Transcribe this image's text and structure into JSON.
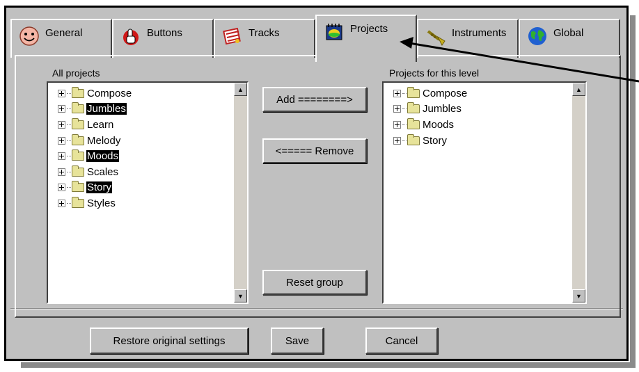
{
  "tabs": [
    {
      "label": "General",
      "icon": "smiley-icon"
    },
    {
      "label": "Buttons",
      "icon": "hand-pointer-icon"
    },
    {
      "label": "Tracks",
      "icon": "tracks-icon"
    },
    {
      "label": "Projects",
      "icon": "projects-icon",
      "active": true
    },
    {
      "label": "Instruments",
      "icon": "trumpet-icon"
    },
    {
      "label": "Global",
      "icon": "globe-icon"
    }
  ],
  "left": {
    "label": "All projects",
    "items": [
      {
        "name": "Compose",
        "selected": false
      },
      {
        "name": "Jumbles",
        "selected": true
      },
      {
        "name": "Learn",
        "selected": false
      },
      {
        "name": "Melody",
        "selected": false
      },
      {
        "name": "Moods",
        "selected": true
      },
      {
        "name": "Scales",
        "selected": false
      },
      {
        "name": "Story",
        "selected": true
      },
      {
        "name": "Styles",
        "selected": false
      }
    ]
  },
  "right": {
    "label": "Projects for this level",
    "items": [
      {
        "name": "Compose"
      },
      {
        "name": "Jumbles"
      },
      {
        "name": "Moods"
      },
      {
        "name": "Story"
      }
    ]
  },
  "buttons": {
    "add": "Add ========>",
    "remove": "<===== Remove",
    "reset": "Reset group",
    "restore": "Restore original settings",
    "save": "Save",
    "cancel": "Cancel"
  },
  "colors": {
    "dialog_bg": "#c0c0c0",
    "selection_bg": "#000000",
    "folder": "#e7e39a"
  }
}
